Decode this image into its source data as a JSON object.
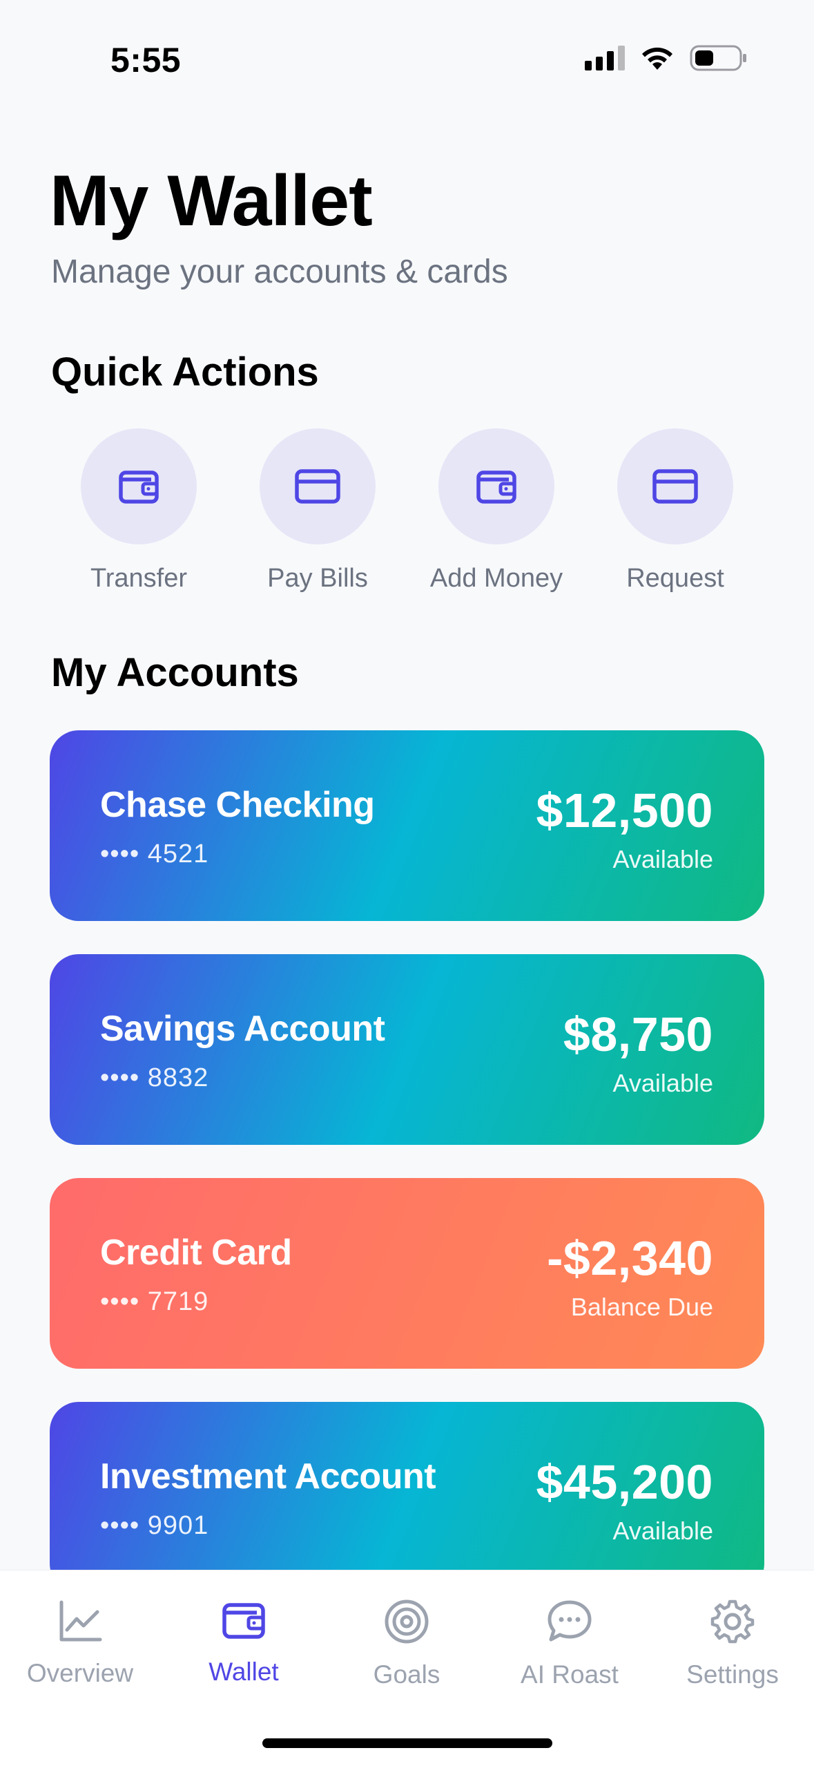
{
  "status_bar": {
    "time": "5:55"
  },
  "header": {
    "title": "My Wallet",
    "subtitle": "Manage your accounts & cards"
  },
  "quick_actions": {
    "title": "Quick Actions",
    "items": [
      {
        "label": "Transfer",
        "icon": "wallet-icon"
      },
      {
        "label": "Pay Bills",
        "icon": "credit-card-icon"
      },
      {
        "label": "Add Money",
        "icon": "wallet-icon"
      },
      {
        "label": "Request",
        "icon": "credit-card-icon"
      }
    ]
  },
  "accounts": {
    "title": "My Accounts",
    "items": [
      {
        "name": "Chase Checking",
        "number": "•••• 4521",
        "amount": "$12,500",
        "amount_label": "Available"
      },
      {
        "name": "Savings Account",
        "number": "•••• 8832",
        "amount": "$8,750",
        "amount_label": "Available"
      },
      {
        "name": "Credit Card",
        "number": "•••• 7719",
        "amount": "-$2,340",
        "amount_label": "Balance Due"
      },
      {
        "name": "Investment Account",
        "number": "•••• 9901",
        "amount": "$45,200",
        "amount_label": "Available"
      }
    ]
  },
  "tabbar": {
    "items": [
      {
        "label": "Overview",
        "icon": "chart-line-icon"
      },
      {
        "label": "Wallet",
        "icon": "wallet-icon",
        "active": true
      },
      {
        "label": "Goals",
        "icon": "target-icon"
      },
      {
        "label": "AI Roast",
        "icon": "chat-bubble-icon"
      },
      {
        "label": "Settings",
        "icon": "gear-icon"
      }
    ]
  },
  "colors": {
    "accent": "#4F46E5",
    "card_gradient_blue": [
      "#4F46E5",
      "#06B6D4",
      "#10B981"
    ],
    "card_gradient_orange": [
      "#FF6B6B",
      "#FF8A55"
    ],
    "background": "#F8F9FB"
  }
}
